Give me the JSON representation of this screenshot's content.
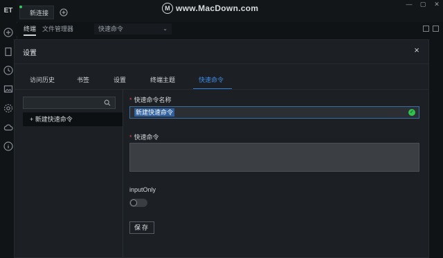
{
  "app": {
    "rail_logo": "ET",
    "rail_icons": [
      "plus-circle-icon",
      "document-icon",
      "clock-icon",
      "image-icon",
      "gear-icon",
      "cloud-icon",
      "info-icon"
    ],
    "watermark_mark": "M",
    "watermark_text": "www.MacDown.com"
  },
  "topbar": {
    "tab_label": "新连接"
  },
  "subtabs": {
    "terminal": "终端",
    "file_manager": "文件管理器",
    "quick_command_select": "快速命令"
  },
  "modal": {
    "title": "设置",
    "close_glyph": "×",
    "tabs": [
      {
        "label": "访问历史"
      },
      {
        "label": "书签"
      },
      {
        "label": "设置"
      },
      {
        "label": "终端主题"
      },
      {
        "label": "快速命令"
      }
    ],
    "active_tab": 4,
    "sidebar": {
      "search_placeholder": "",
      "new_item_label": "新建快速命令"
    },
    "form": {
      "name_label": "快速命令名称",
      "name_value": "新建快速命令",
      "command_label": "快速命令",
      "command_value": "",
      "toggle_label": "inputOnly",
      "toggle_on": false,
      "save_label": "保存"
    }
  },
  "colors": {
    "accent": "#2d7fdb",
    "success": "#31c24e",
    "required": "#e0484b"
  }
}
